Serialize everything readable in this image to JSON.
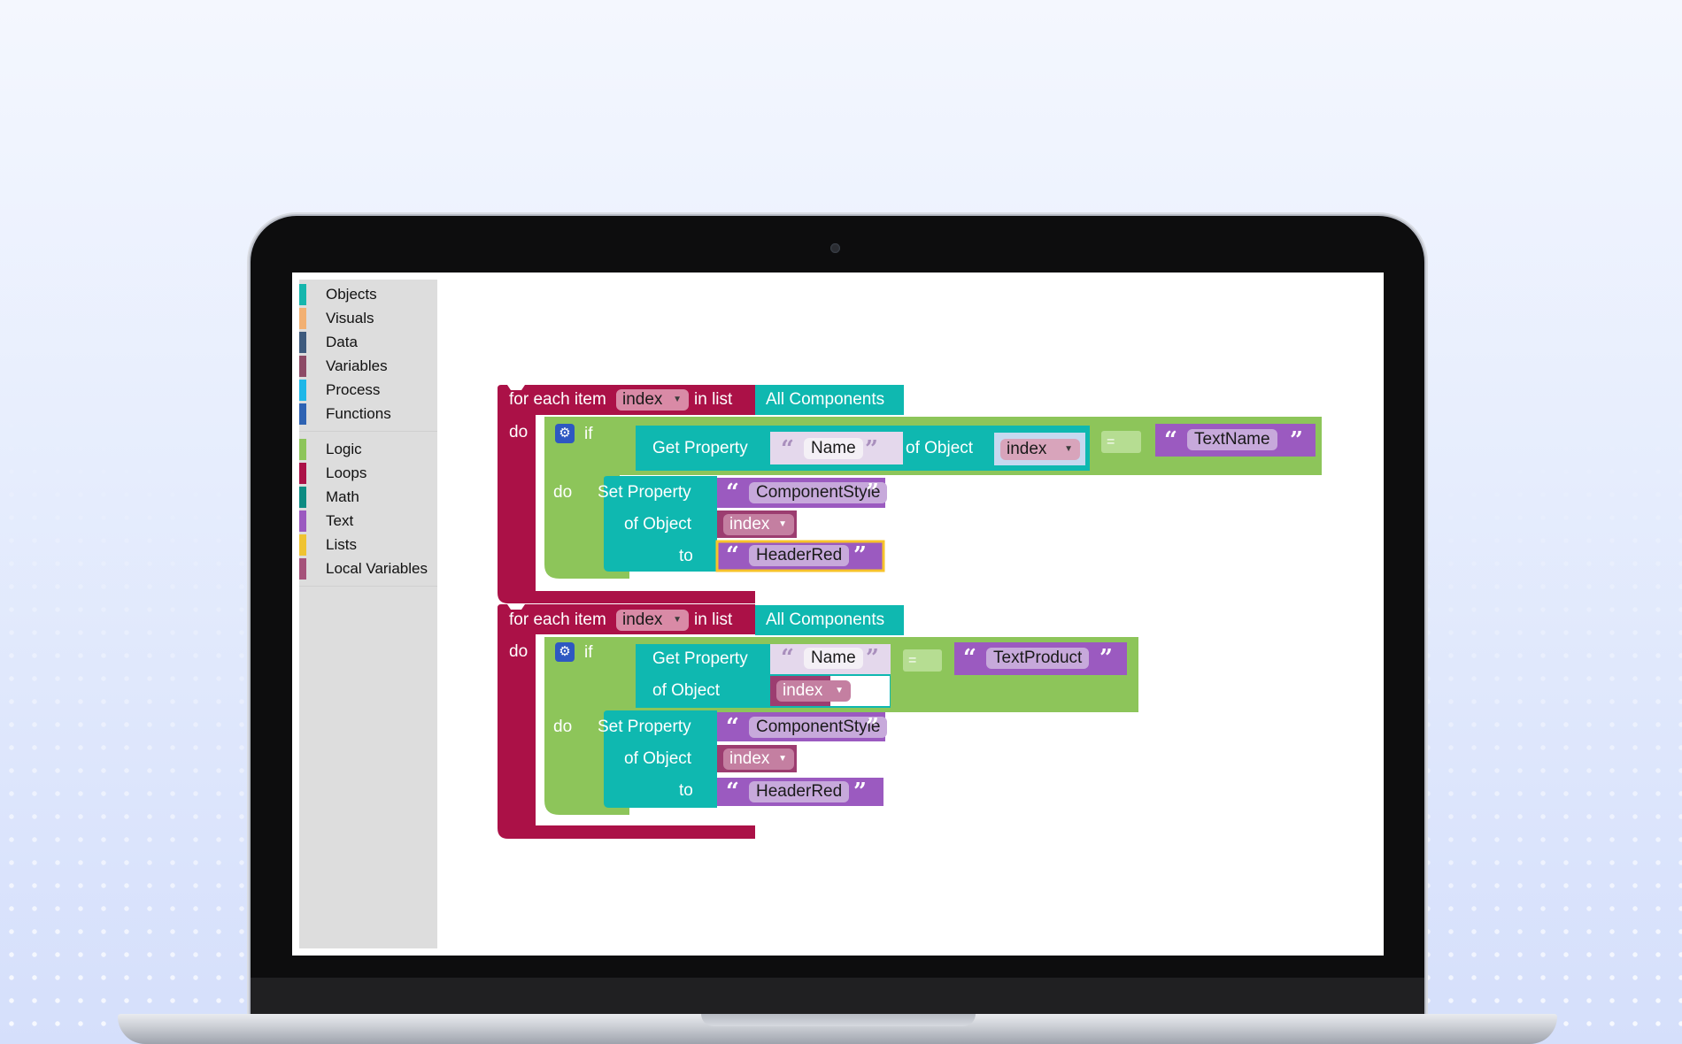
{
  "toolbox": {
    "categories": [
      {
        "label": "Objects",
        "color": "#15b6ad"
      },
      {
        "label": "Visuals",
        "color": "#f2b072"
      },
      {
        "label": "Data",
        "color": "#3e5a7d"
      },
      {
        "label": "Variables",
        "color": "#8d4a66"
      },
      {
        "label": "Process",
        "color": "#1eb7e8"
      },
      {
        "label": "Functions",
        "color": "#2e63b3"
      }
    ],
    "categories2": [
      {
        "label": "Logic",
        "color": "#8dc55a"
      },
      {
        "label": "Loops",
        "color": "#ab1147"
      },
      {
        "label": "Math",
        "color": "#0c8b82"
      },
      {
        "label": "Text",
        "color": "#9b5ac0"
      },
      {
        "label": "Lists",
        "color": "#efc332"
      },
      {
        "label": "Local Variables",
        "color": "#a5527a"
      }
    ]
  },
  "colors": {
    "loop": "#ab1147",
    "logic": "#8dc55a",
    "object": "#0fb8b0",
    "text": "#9b5ac0"
  },
  "block1": {
    "for_each": "for each item",
    "var": "index",
    "in_list": "in list",
    "list": "All Components",
    "do": "do",
    "if": "if",
    "get_property": "Get Property",
    "prop_name": "Name",
    "of_object": "of Object",
    "obj_var": "index",
    "op": "=",
    "compare_text": "TextName",
    "do2": "do",
    "set_property": "Set Property",
    "set_prop_name": "ComponentStyle",
    "set_of_object": "of Object",
    "set_obj_var": "index",
    "to": "to",
    "to_value": "HeaderRed"
  },
  "block2": {
    "for_each": "for each item",
    "var": "index",
    "in_list": "in list",
    "list": "All Components",
    "do": "do",
    "if": "if",
    "get_property": "Get Property",
    "prop_name": "Name",
    "of_object": "of Object",
    "obj_var": "index",
    "op": "=",
    "compare_text": "TextProduct",
    "do2": "do",
    "set_property": "Set Property",
    "set_prop_name": "ComponentStyle",
    "set_of_object": "of Object",
    "set_obj_var": "index",
    "to": "to",
    "to_value": "HeaderRed"
  },
  "icons": {
    "dropdown": "▼",
    "quote_open": "“",
    "quote_close": "”",
    "gear": "⚙"
  }
}
